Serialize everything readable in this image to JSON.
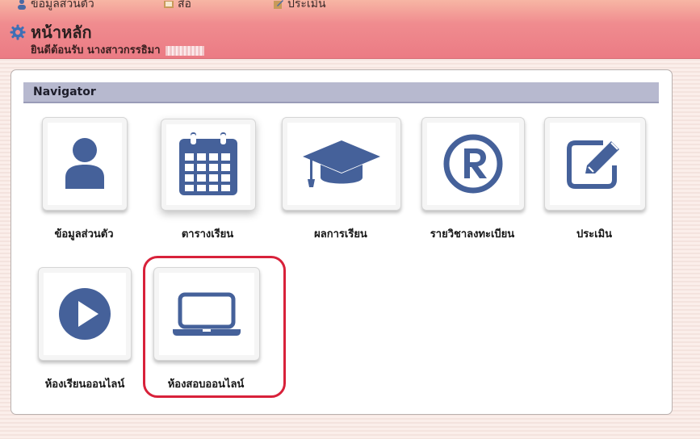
{
  "topnav": {
    "items": [
      {
        "label": "ข้อมูลส่วนตัว",
        "icon": "person-icon"
      },
      {
        "label": "สื่อ",
        "icon": "book-icon"
      },
      {
        "label": "ประเมิน",
        "icon": "edit-icon"
      }
    ]
  },
  "header": {
    "title": "หน้าหลัก",
    "welcome": "ยินดีต้อนรับ นางสาวกรรธิมา"
  },
  "navigator": {
    "title": "Navigator",
    "tiles": [
      {
        "label": "ข้อมูลส่วนตัว",
        "icon": "user-icon"
      },
      {
        "label": "ตารางเรียน",
        "icon": "calendar-icon"
      },
      {
        "label": "ผลการเรียน",
        "icon": "graduation-cap-icon"
      },
      {
        "label": "รายวิชาลงทะเบียน",
        "icon": "registered-icon"
      },
      {
        "label": "ประเมิน",
        "icon": "edit-icon"
      },
      {
        "label": "ห้องเรียนออนไลน์",
        "icon": "play-icon"
      },
      {
        "label": "ห้องสอบออนไลน์",
        "icon": "laptop-icon"
      }
    ]
  },
  "colors": {
    "icon": "#45619a",
    "highlight": "#d8213a",
    "header": "#f08c8f"
  }
}
